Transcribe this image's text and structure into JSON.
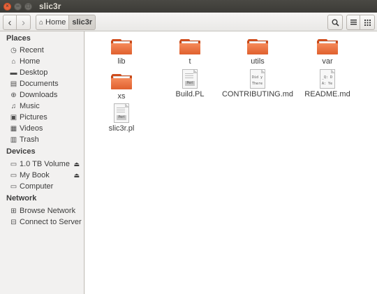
{
  "window": {
    "title": "slic3r",
    "close_glyph": "×",
    "minimize_glyph": "–",
    "maximize_glyph": "□"
  },
  "toolbar": {
    "back_glyph": "‹",
    "forward_glyph": "›",
    "breadcrumbs": [
      {
        "label": "Home",
        "icon": "home-icon"
      },
      {
        "label": "slic3r"
      }
    ],
    "search_glyph": "⚲",
    "menu_glyph": "≡",
    "view_glyph": "⣿"
  },
  "sidebar": {
    "sections": [
      {
        "title": "Places",
        "items": [
          {
            "label": "Recent",
            "icon": "recent-icon",
            "glyph": "◷"
          },
          {
            "label": "Home",
            "icon": "home-icon",
            "glyph": "⌂"
          },
          {
            "label": "Desktop",
            "icon": "desktop-icon",
            "glyph": "▬"
          },
          {
            "label": "Documents",
            "icon": "documents-icon",
            "glyph": "▤"
          },
          {
            "label": "Downloads",
            "icon": "downloads-icon",
            "glyph": "⊕"
          },
          {
            "label": "Music",
            "icon": "music-icon",
            "glyph": "♫"
          },
          {
            "label": "Pictures",
            "icon": "pictures-icon",
            "glyph": "▣"
          },
          {
            "label": "Videos",
            "icon": "videos-icon",
            "glyph": "▦"
          },
          {
            "label": "Trash",
            "icon": "trash-icon",
            "glyph": "▥"
          }
        ]
      },
      {
        "title": "Devices",
        "items": [
          {
            "label": "1.0 TB Volume",
            "icon": "drive-icon",
            "glyph": "▭",
            "eject": "⏏"
          },
          {
            "label": "My Book",
            "icon": "drive-icon",
            "glyph": "▭",
            "eject": "⏏"
          },
          {
            "label": "Computer",
            "icon": "computer-icon",
            "glyph": "▭"
          }
        ]
      },
      {
        "title": "Network",
        "items": [
          {
            "label": "Browse Network",
            "icon": "network-icon",
            "glyph": "⊞"
          },
          {
            "label": "Connect to Server",
            "icon": "server-icon",
            "glyph": "⊟"
          }
        ]
      }
    ]
  },
  "files": [
    {
      "name": "lib",
      "type": "folder"
    },
    {
      "name": "t",
      "type": "folder"
    },
    {
      "name": "utils",
      "type": "folder"
    },
    {
      "name": "var",
      "type": "folder"
    },
    {
      "name": "xs",
      "type": "folder"
    },
    {
      "name": "Build.PL",
      "type": "perl",
      "badge": "Perl"
    },
    {
      "name": "CONTRIBUTING.md",
      "type": "text",
      "preview": [
        "Did y",
        "There"
      ]
    },
    {
      "name": "README.md",
      "type": "text",
      "preview": [
        "_Q: D",
        "A: Ye"
      ]
    },
    {
      "name": "slic3r.pl",
      "type": "perl",
      "badge": "Perl"
    }
  ]
}
